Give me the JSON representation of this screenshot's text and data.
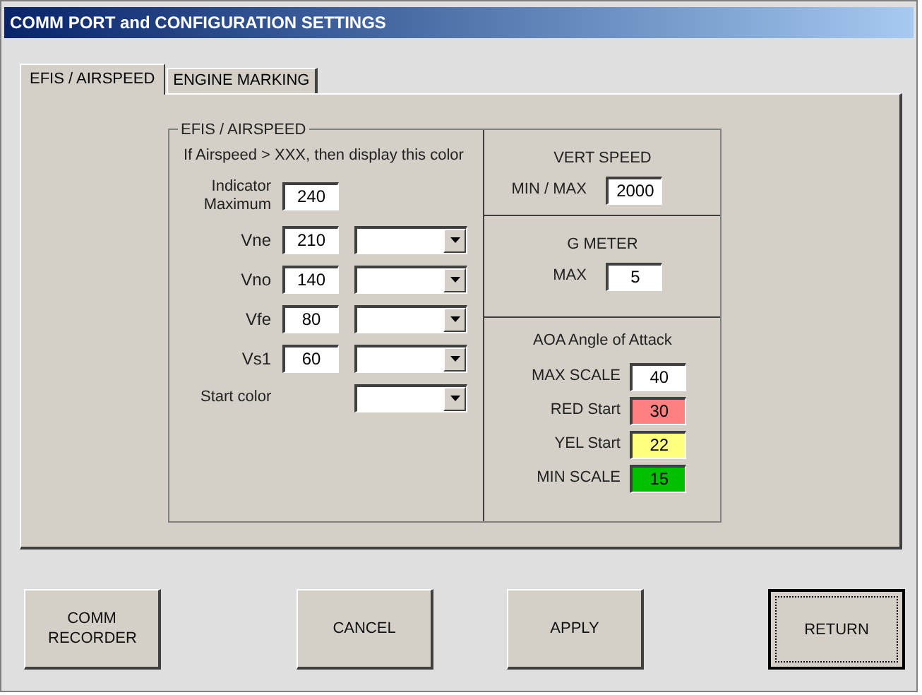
{
  "window": {
    "title": "COMM PORT and CONFIGURATION SETTINGS"
  },
  "tabs": [
    {
      "label": "EFIS / AIRSPEED",
      "selected": true
    },
    {
      "label": "ENGINE MARKING",
      "selected": false
    }
  ],
  "airspeed": {
    "title": "EFIS / AIRSPEED",
    "hint": "If Airspeed > XXX,  then display this color",
    "indicator_max": {
      "label": "Indicator Maximum",
      "value": "240"
    },
    "rows": [
      {
        "label": "Vne",
        "value": "210"
      },
      {
        "label": "Vno",
        "value": "140"
      },
      {
        "label": "Vfe",
        "value": "80"
      },
      {
        "label": "Vs1",
        "value": "60"
      }
    ],
    "start_color": {
      "label": "Start color"
    }
  },
  "vert_speed": {
    "title": "VERT SPEED",
    "label": "MIN / MAX",
    "value": "2000"
  },
  "g_meter": {
    "title": "G METER",
    "label": "MAX",
    "value": "5"
  },
  "aoa": {
    "title": "AOA Angle of Attack",
    "rows": [
      {
        "label": "MAX SCALE",
        "value": "40",
        "color": "#ffffff"
      },
      {
        "label": "RED Start",
        "value": "30",
        "color": "#ff8080"
      },
      {
        "label": "YEL Start",
        "value": "22",
        "color": "#ffff80"
      },
      {
        "label": "MIN SCALE",
        "value": "15",
        "color": "#00c000"
      }
    ]
  },
  "buttons": [
    {
      "label": "COMM RECORDER",
      "default": false
    },
    {
      "label": "CANCEL",
      "default": false
    },
    {
      "label": "APPLY",
      "default": false
    },
    {
      "label": "RETURN",
      "default": true
    }
  ]
}
